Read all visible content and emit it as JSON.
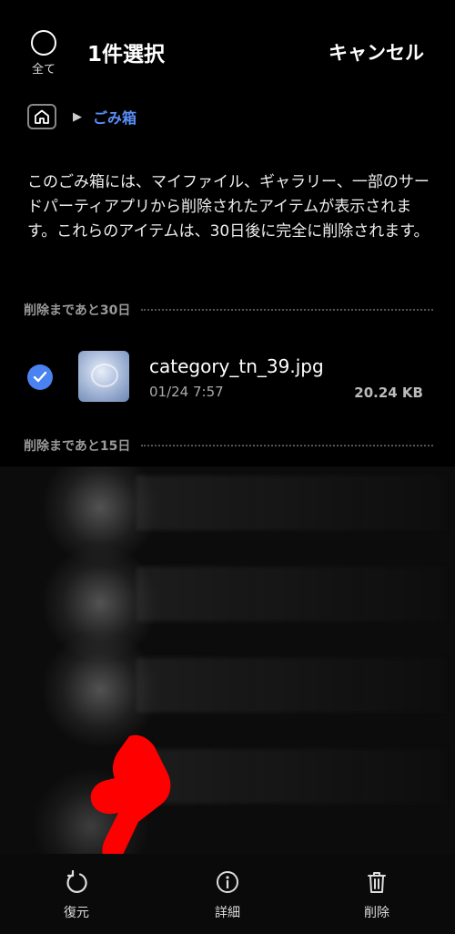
{
  "header": {
    "select_all_label": "全て",
    "title": "1件選択",
    "cancel_label": "キャンセル"
  },
  "breadcrumb": {
    "home_icon": "home-icon",
    "current": "ごみ箱"
  },
  "description": "このごみ箱には、マイファイル、ギャラリー、一部のサードパーティアプリから削除されたアイテムが表示されます。これらのアイテムは、30日後に完全に削除されます。",
  "sections": [
    {
      "label": "削除まであと30日",
      "files": [
        {
          "name": "category_tn_39.jpg",
          "date": "01/24 7:57",
          "size": "20.24 KB",
          "selected": true
        }
      ]
    },
    {
      "label": "削除まであと15日",
      "files": []
    }
  ],
  "bottom_bar": {
    "restore_label": "復元",
    "details_label": "詳細",
    "delete_label": "削除"
  },
  "colors": {
    "accent": "#5b8ff9",
    "checkbox": "#4a82f0",
    "pointer_hand": "#ff0000"
  }
}
